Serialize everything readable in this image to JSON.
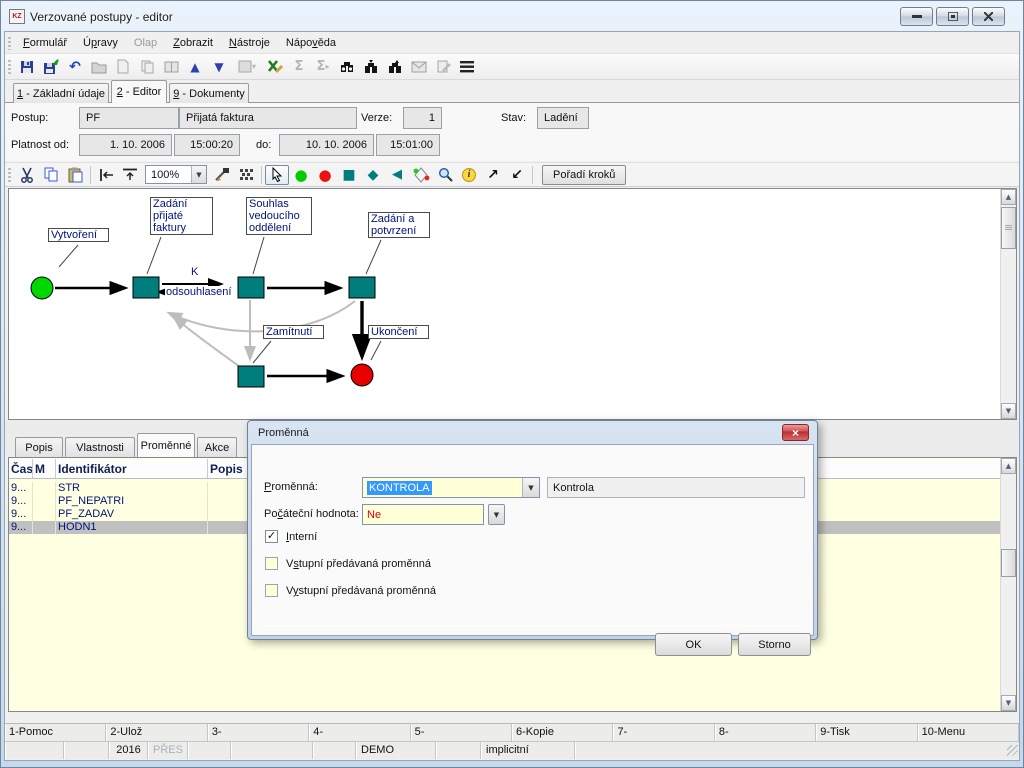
{
  "window": {
    "title": "Verzované postupy - editor"
  },
  "menu": {
    "items": [
      {
        "pre": "",
        "key": "F",
        "post": "ormulář"
      },
      {
        "pre": "Ú",
        "key": "p",
        "post": "ravy"
      },
      {
        "pre": "Olap",
        "key": "",
        "post": ""
      },
      {
        "pre": "",
        "key": "Z",
        "post": "obrazit"
      },
      {
        "pre": "",
        "key": "N",
        "post": "ástroje"
      },
      {
        "pre": "Nápo",
        "key": "v",
        "post": "ěda"
      }
    ]
  },
  "toolbar_main": {
    "icons": [
      "save",
      "save-as",
      "undo",
      "open",
      "new",
      "copy",
      "notebook",
      "move-up",
      "move-down",
      "options",
      "excel-edit",
      "sum",
      "sum-export",
      "find",
      "find-next",
      "find-prev",
      "mail",
      "edit-note",
      "menu-list"
    ]
  },
  "tabs": {
    "active": "2 - Editor",
    "items": [
      {
        "key": "1",
        "post": " - Základní údaje"
      },
      {
        "key": "2",
        "post": " - Editor"
      },
      {
        "key": "9",
        "post": " - Dokumenty"
      }
    ]
  },
  "form": {
    "postup_label": "Postup:",
    "postup_code": "PF",
    "postup_name": "Přijatá faktura",
    "verze_label": "Verze:",
    "verze_value": "1",
    "stav_label": "Stav:",
    "stav_value": "Ladění",
    "platnost_label": "Platnost od:",
    "od_date": "1. 10. 2006",
    "od_time": "15:00:20",
    "do_label": "do:",
    "do_date": "10. 10. 2006",
    "do_time": "15:01:00"
  },
  "editor_toolbar": {
    "icons": [
      "cut",
      "copy",
      "paste",
      "align-edge",
      "align-top",
      "zoom-select",
      "properties",
      "bitmap",
      "select-cursor",
      "start-node",
      "end-node",
      "activity-node",
      "decision-node",
      "subprocess-node",
      "condition-node",
      "zoom-tool",
      "info-tool",
      "link-forward",
      "link-back"
    ],
    "zoom_value": "100%",
    "order_button": "Pořadí kroků"
  },
  "diagram": {
    "colors": {
      "activity": "#007d7d",
      "start": "#00d800",
      "end": "#e80000"
    },
    "labels": {
      "vytvoreni": "Vytvoření",
      "zadani_prijate": "Zadání přijaté faktury",
      "souhlas": "Souhlas vedoucího oddělení",
      "zadani_potvrzeni": "Zadání a potvrzení",
      "edge_k": "K",
      "edge_odsouhlaseni": "odsouhlasení",
      "zamitnuti": "Zamítnutí",
      "ukonceni": "Ukončení"
    }
  },
  "bottom_tabs": {
    "active": "Proměnné",
    "items": [
      "Popis",
      "Vlastnosti",
      "Proměnné",
      "Akce"
    ]
  },
  "table": {
    "columns": [
      "Čas",
      "M",
      "Identifikátor",
      "Popis"
    ],
    "rows": [
      {
        "cas": "9...",
        "m": "",
        "id": "STR",
        "popis": ""
      },
      {
        "cas": "9...",
        "m": "",
        "id": "PF_NEPATRI",
        "popis": ""
      },
      {
        "cas": "9...",
        "m": "",
        "id": "PF_ZADAV",
        "popis": ""
      },
      {
        "cas": "9...",
        "m": "",
        "id": "HODN1",
        "popis": ""
      }
    ],
    "selected_id": "HODN1"
  },
  "dialog": {
    "title": "Proměnná",
    "promenna_label": {
      "pre": "",
      "key": "P",
      "post": "roměnná:"
    },
    "promenna_value": "KONTROLA",
    "promenna_desc": "Kontrola",
    "hodnota_label": {
      "pre": "Po",
      "key": "č",
      "post": "áteční hodnota:"
    },
    "hodnota_value": "Ne",
    "checkboxes": [
      {
        "pre": "",
        "key": "I",
        "post": "nterní",
        "checked": true
      },
      {
        "pre": "V",
        "key": "s",
        "post": "tupní předávaná proměnná",
        "checked": false
      },
      {
        "pre": "V",
        "key": "y",
        "post": "stupní předávaná proměnná",
        "checked": false
      }
    ],
    "ok": "OK",
    "storno": "Storno"
  },
  "status": {
    "fkeys": [
      "1-Pomoc",
      "2-Ulož",
      "3-",
      "4-",
      "5-",
      "6-Kopie",
      "7-",
      "8-",
      "9-Tisk",
      "10-Menu"
    ],
    "info": {
      "year": "2016",
      "pres": "PŘES",
      "demo": "DEMO",
      "implicit": "implicitní"
    }
  }
}
